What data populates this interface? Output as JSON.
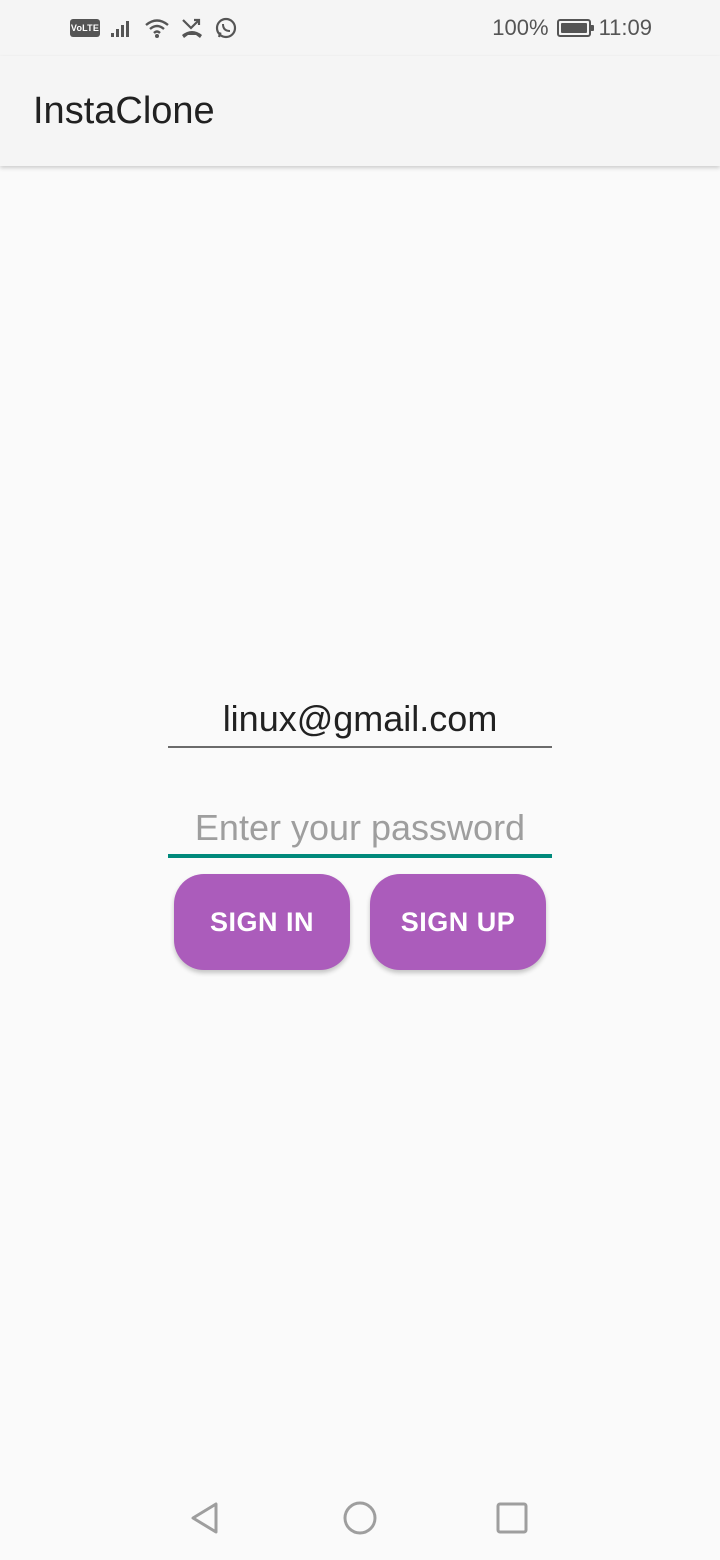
{
  "status_bar": {
    "volte_label": "VoLTE",
    "battery_text": "100%",
    "time": "11:09",
    "icons": [
      "volte-icon",
      "signal-icon",
      "wifi-icon",
      "missed-call-icon",
      "whatsapp-icon",
      "battery-icon"
    ]
  },
  "app_bar": {
    "title": "InstaClone"
  },
  "form": {
    "email_value": "linux@gmail.com",
    "password_placeholder": "Enter your password",
    "password_value": "",
    "signin_label": "SIGN IN",
    "signup_label": "SIGN UP"
  },
  "nav_bar": {
    "icons": [
      "back-icon",
      "home-icon",
      "recents-icon"
    ]
  },
  "colors": {
    "background": "#fafafa",
    "app_bar": "#f5f5f5",
    "button": "#ab5cbb",
    "focus_underline": "#00897b"
  }
}
